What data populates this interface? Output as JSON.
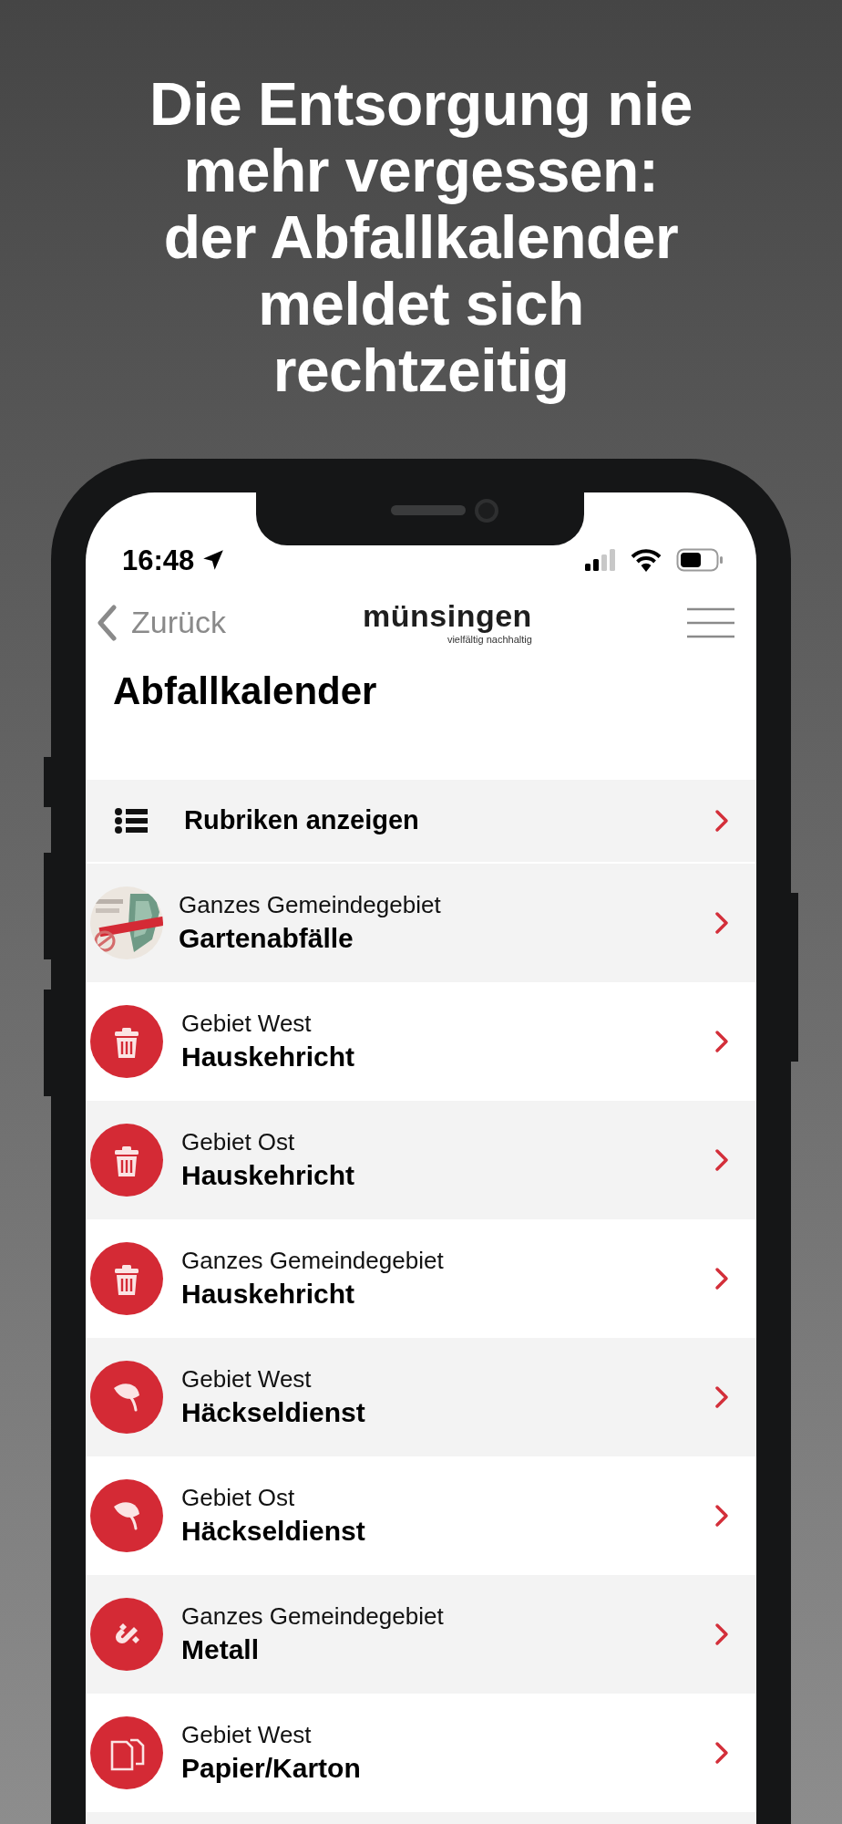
{
  "headline_lines": [
    "Die Entsorgung nie",
    "mehr vergessen:",
    "der Abfallkalender",
    "meldet sich",
    "rechtzeitig"
  ],
  "status_bar": {
    "time": "16:48"
  },
  "nav": {
    "back": "Zurück",
    "logo": {
      "name": "münsingen",
      "tagline": "vielfältig nachhaltig"
    }
  },
  "page_title": "Abfallkalender",
  "categories_row": {
    "label": "Rubriken anzeigen"
  },
  "items": [
    {
      "kind": "picture",
      "area": "Ganzes Gemeindegebiet",
      "title": "Gartenabfälle"
    },
    {
      "kind": "trash",
      "area": "Gebiet West",
      "title": "Hauskehricht"
    },
    {
      "kind": "trash",
      "area": "Gebiet Ost",
      "title": "Hauskehricht"
    },
    {
      "kind": "trash",
      "area": "Ganzes Gemeindegebiet",
      "title": "Hauskehricht"
    },
    {
      "kind": "leaf",
      "area": "Gebiet West",
      "title": "Häckseldienst"
    },
    {
      "kind": "leaf",
      "area": "Gebiet Ost",
      "title": "Häckseldienst"
    },
    {
      "kind": "magnet",
      "area": "Ganzes Gemeindegebiet",
      "title": "Metall"
    },
    {
      "kind": "paper",
      "area": "Gebiet West",
      "title": "Papier/Karton"
    }
  ]
}
